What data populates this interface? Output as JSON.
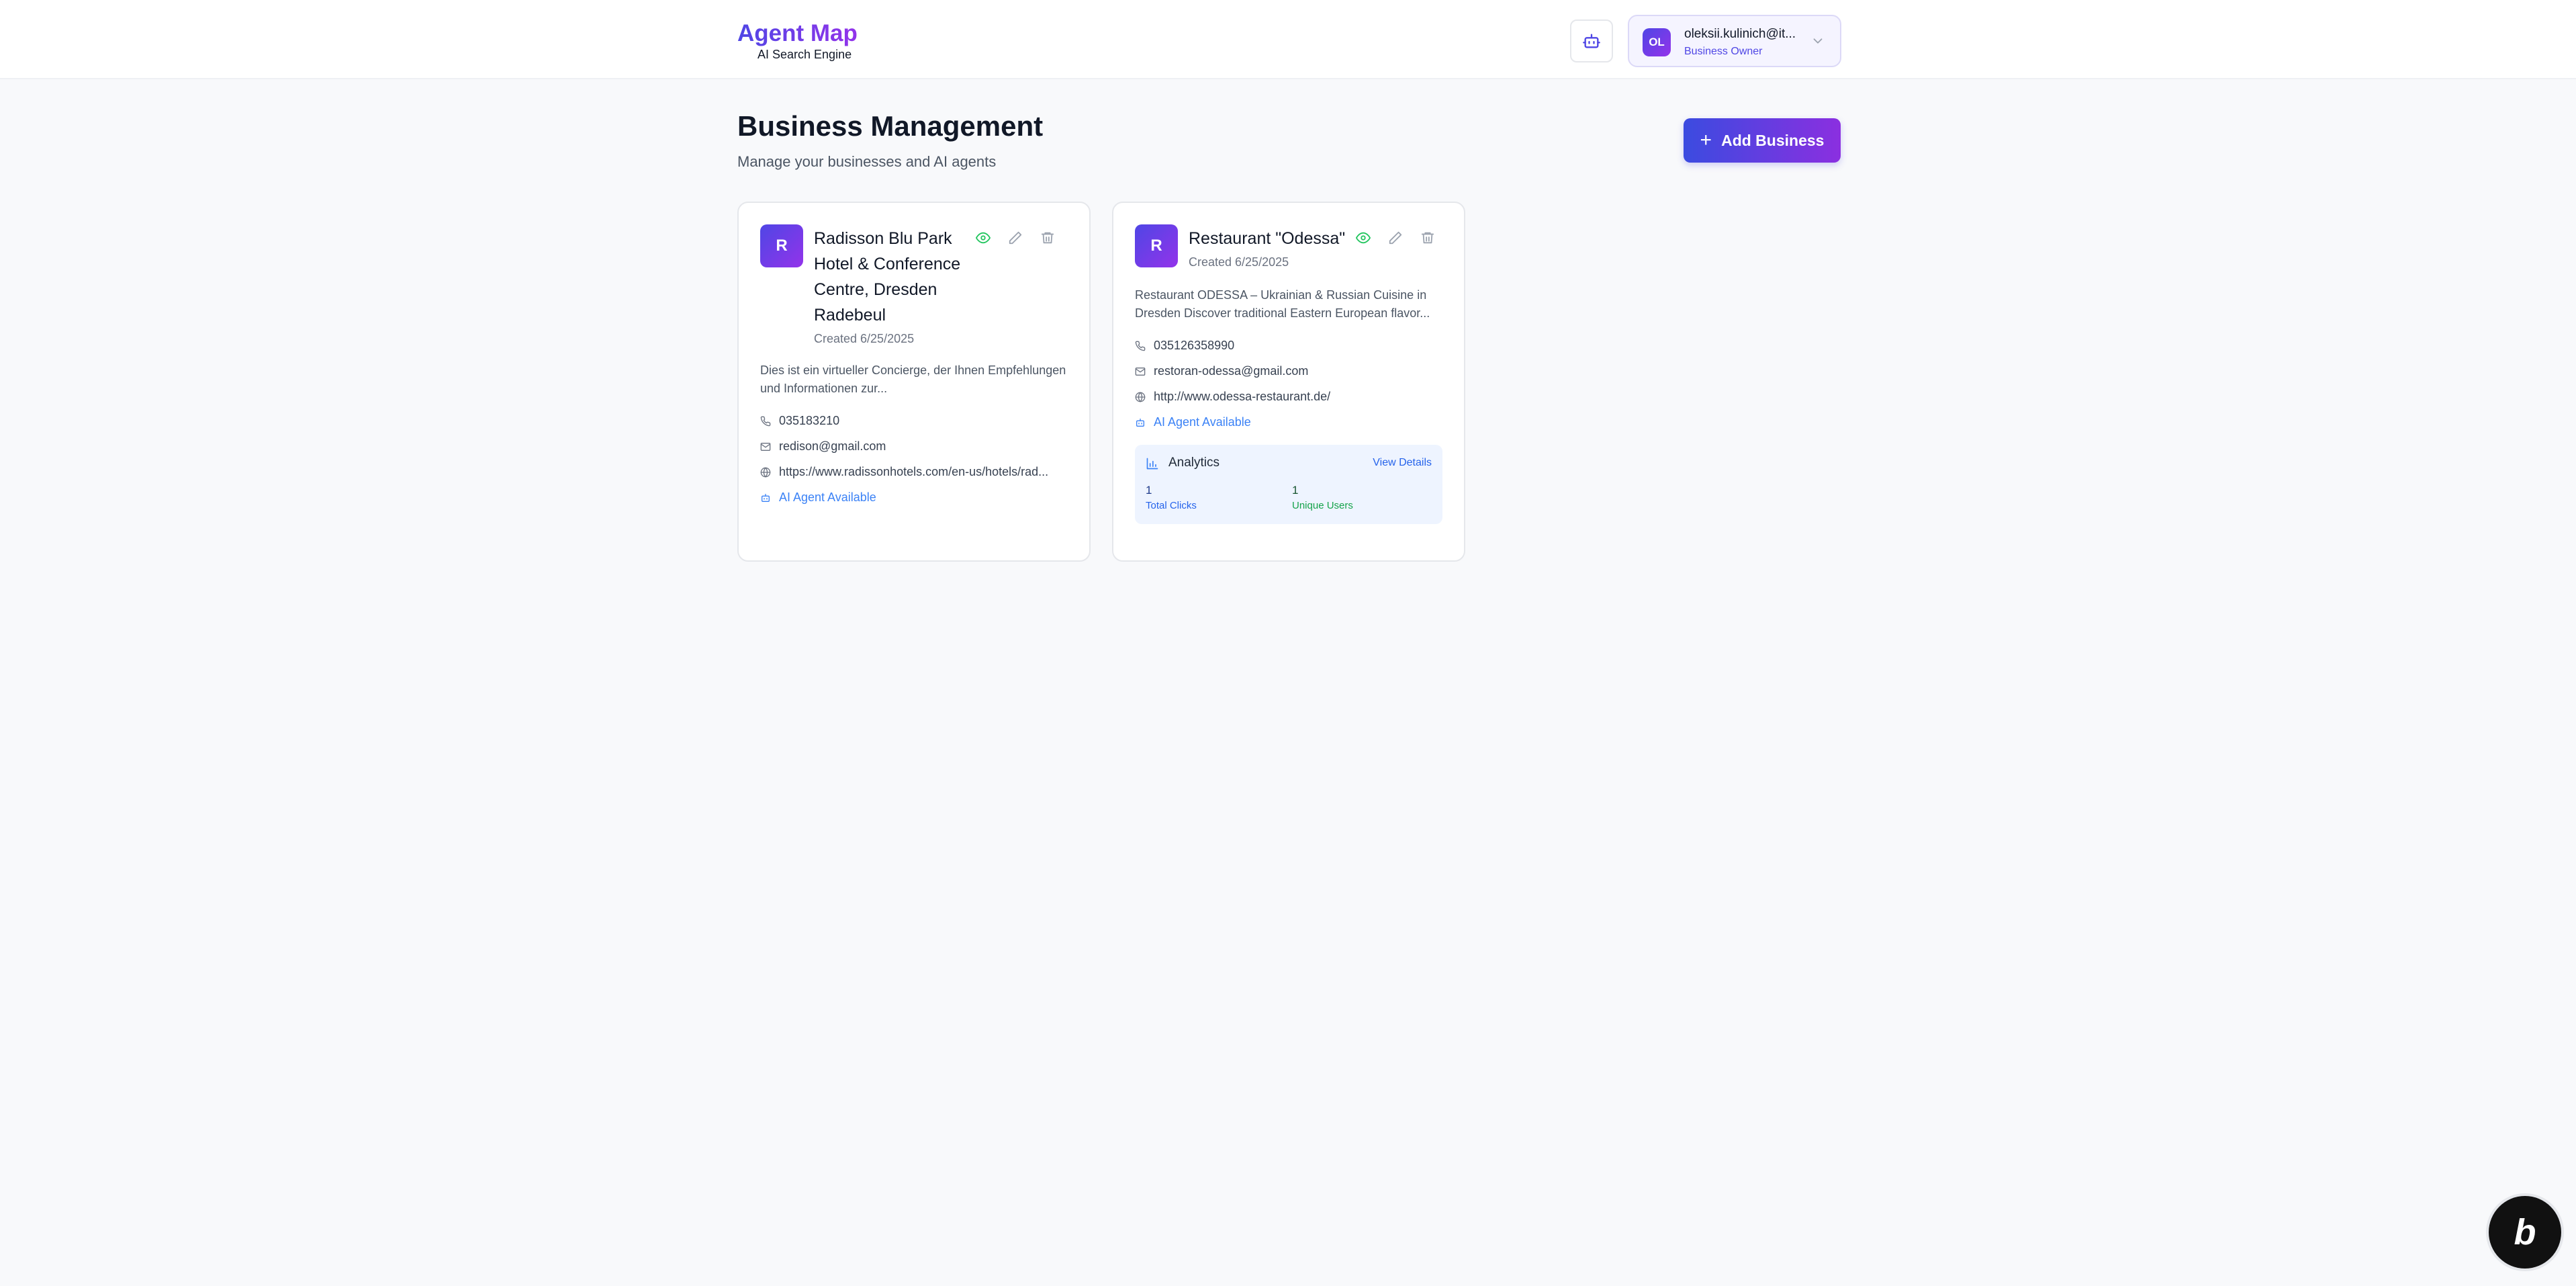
{
  "header": {
    "brand_title": "Agent Map",
    "brand_subtitle": "AI Search Engine",
    "bot_icon": "robot-icon",
    "user": {
      "initials": "OL",
      "email": "oleksii.kulinich@it...",
      "role": "Business Owner"
    }
  },
  "page": {
    "title": "Business Management",
    "subtitle": "Manage your businesses and AI agents",
    "add_button": "Add Business"
  },
  "businesses": [
    {
      "initial": "R",
      "name": "Radisson Blu Park Hotel & Conference Centre, Dresden Radebeul",
      "created": "Created 6/25/2025",
      "description": "Dies ist ein virtueller Concierge, der Ihnen Empfehlungen und Informationen zur...",
      "phone": "035183210",
      "email": "redison@gmail.com",
      "website": "https://www.radissonhotels.com/en-us/hotels/rad...",
      "ai_agent": "AI Agent Available"
    },
    {
      "initial": "R",
      "name": "Restaurant \"Odessa\"",
      "created": "Created 6/25/2025",
      "description": "Restaurant ODESSA – Ukrainian & Russian Cuisine in Dresden Discover traditional Eastern European flavor...",
      "phone": "035126358990",
      "email": "restoran-odessa@gmail.com",
      "website": "http://www.odessa-restaurant.de/",
      "ai_agent": "AI Agent Available",
      "analytics": {
        "title": "Analytics",
        "link": "View Details",
        "total_clicks": "1",
        "total_clicks_label": "Total Clicks",
        "unique_users": "1",
        "unique_users_label": "Unique Users"
      }
    }
  ],
  "colors": {
    "accent": "#4f46e5",
    "accent_2": "#9333ea",
    "view_icon": "#22c55e",
    "link": "#3b82f6"
  },
  "badge": {
    "letter": "b"
  }
}
